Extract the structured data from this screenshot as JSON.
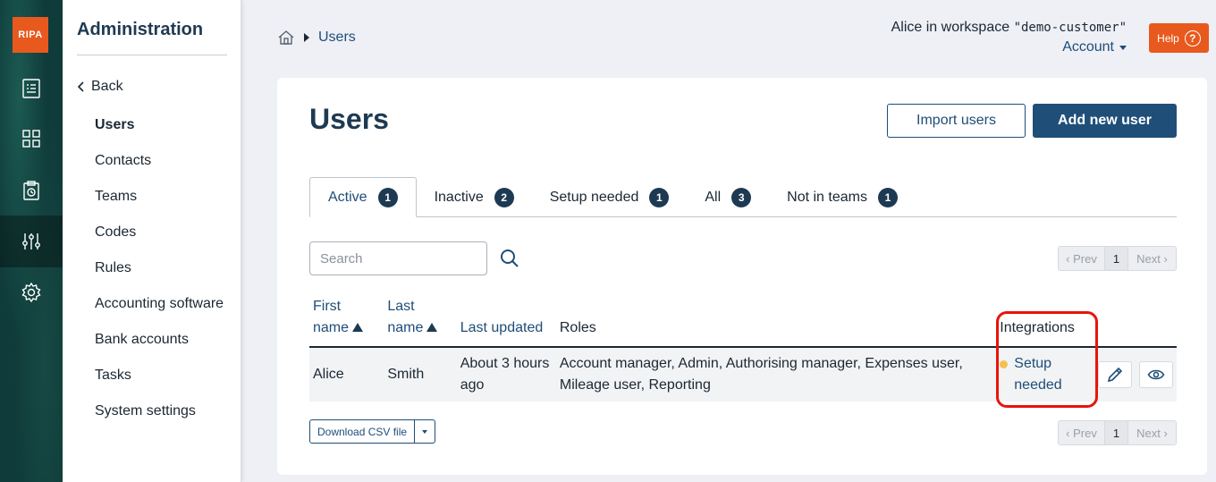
{
  "brand": {
    "logo_text": "RIPA",
    "accent": "#e8591e"
  },
  "rail": {
    "icons": [
      "receipt-icon",
      "grid-icon",
      "clipboard-clock-icon",
      "sliders-icon",
      "gear-icon"
    ],
    "active": "sliders-icon"
  },
  "sidebar": {
    "title": "Administration",
    "back_label": "Back",
    "items": [
      {
        "label": "Users"
      },
      {
        "label": "Contacts"
      },
      {
        "label": "Teams"
      },
      {
        "label": "Codes"
      },
      {
        "label": "Rules"
      },
      {
        "label": "Accounting software"
      },
      {
        "label": "Bank accounts"
      },
      {
        "label": "Tasks"
      },
      {
        "label": "System settings"
      }
    ]
  },
  "breadcrumb": {
    "current": "Users"
  },
  "account": {
    "user_prefix": "Alice in workspace ",
    "workspace": "\"demo-customer\"",
    "account_label": "Account"
  },
  "help": {
    "label": "Help",
    "icon": "?"
  },
  "page": {
    "title": "Users",
    "import_label": "Import users",
    "add_label": "Add new user"
  },
  "tabs": [
    {
      "label": "Active",
      "count": "1"
    },
    {
      "label": "Inactive",
      "count": "2"
    },
    {
      "label": "Setup needed",
      "count": "1"
    },
    {
      "label": "All",
      "count": "3"
    },
    {
      "label": "Not in teams",
      "count": "1"
    }
  ],
  "search": {
    "placeholder": "Search",
    "value": ""
  },
  "pager": {
    "prev": "‹ Prev",
    "page": "1",
    "next": "Next ›"
  },
  "table": {
    "headers": {
      "first_name": [
        "First",
        "name"
      ],
      "last_name": [
        "Last",
        "name"
      ],
      "last_updated": "Last updated",
      "roles": "Roles",
      "integrations": "Integrations"
    },
    "rows": [
      {
        "first_name": "Alice",
        "last_name": "Smith",
        "last_updated": "About 3 hours ago",
        "roles": "Account manager, Admin, Authorising manager, Expenses user, Mileage user, Reporting",
        "integration_status": "Setup needed",
        "status_color": "#f2c14e"
      }
    ]
  },
  "download": {
    "label": "Download CSV file"
  }
}
